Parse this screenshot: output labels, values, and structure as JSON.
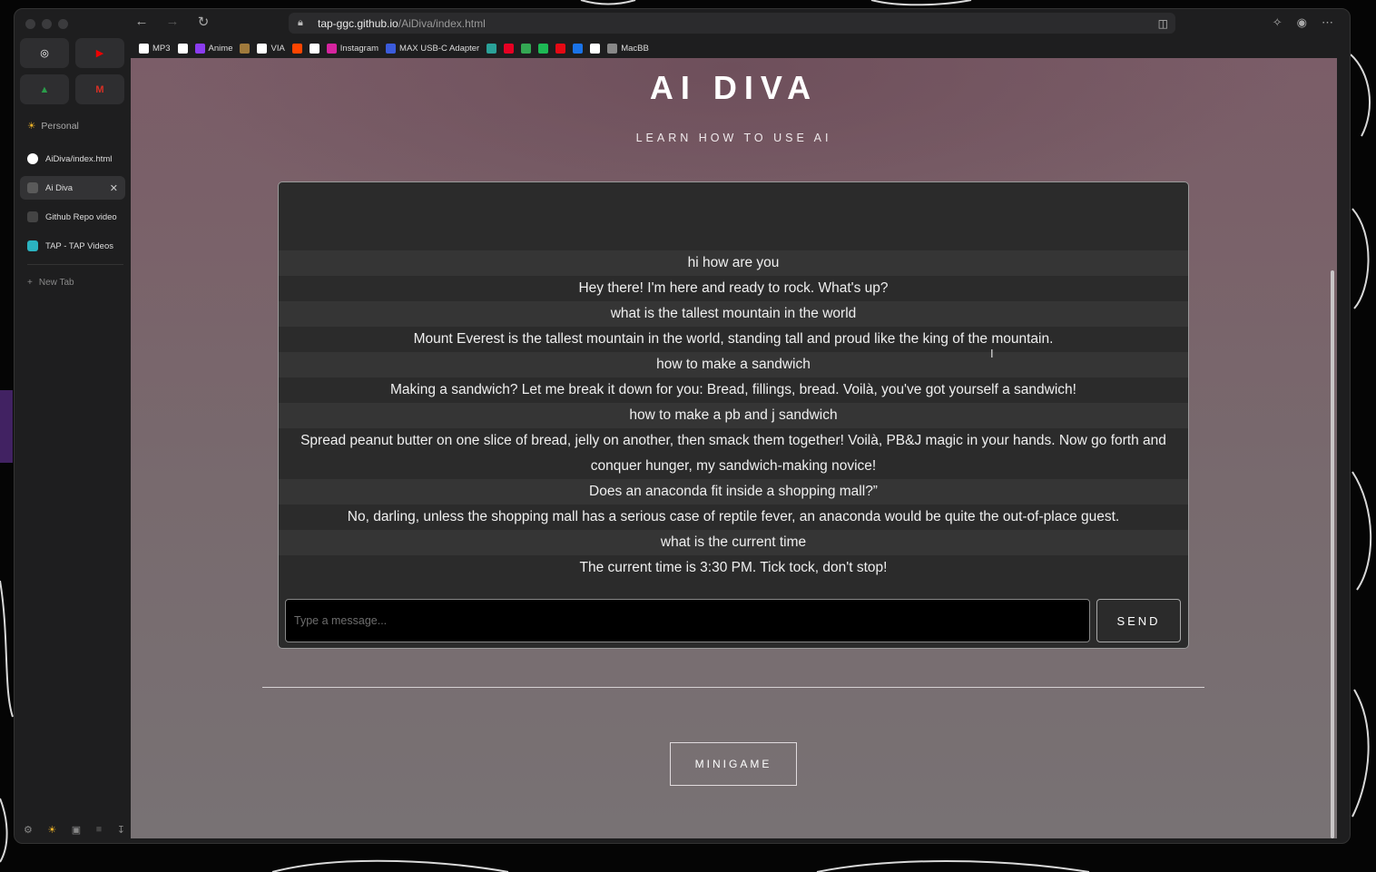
{
  "browser": {
    "url_host": "tap-ggc.github.io",
    "url_path": "/AiDiva/index.html",
    "bookmarks": [
      {
        "label": "MP3",
        "color": "#ffffff"
      },
      {
        "label": "",
        "color": "#ffffff"
      },
      {
        "label": "Anime",
        "color": "#8b3cf0"
      },
      {
        "label": "",
        "color": "#a07a3c"
      },
      {
        "label": "VIA",
        "color": "#ffffff"
      },
      {
        "label": "",
        "color": "#ff4500"
      },
      {
        "label": "",
        "color": "#ffffff"
      },
      {
        "label": "Instagram",
        "color": "#d6249f"
      },
      {
        "label": "MAX USB-C Adapter",
        "color": "#3b5bdb"
      },
      {
        "label": "",
        "color": "#2aa198"
      },
      {
        "label": "",
        "color": "#e60023"
      },
      {
        "label": "",
        "color": "#34a853"
      },
      {
        "label": "",
        "color": "#1db954"
      },
      {
        "label": "",
        "color": "#e50914"
      },
      {
        "label": "",
        "color": "#1a73e8"
      },
      {
        "label": "",
        "color": "#ffffff"
      },
      {
        "label": "MacBB",
        "color": "#888888"
      }
    ]
  },
  "sidebar": {
    "space_label": "Personal",
    "tabs": [
      {
        "label": "AiDiva/index.html",
        "icon": "github-icon",
        "color": "#ffffff",
        "active": false
      },
      {
        "label": "Ai Diva",
        "icon": "page-icon",
        "color": "#5a5a5a",
        "active": true
      },
      {
        "label": "Github Repo video",
        "icon": "dil-icon",
        "color": "#444444",
        "active": false
      },
      {
        "label": "TAP - TAP Videos",
        "icon": "tap-icon",
        "color": "#2bb3c0",
        "active": false
      }
    ],
    "new_tab_label": "New Tab"
  },
  "page": {
    "title": "AI DIVA",
    "subtitle": "LEARN HOW TO USE AI",
    "messages": [
      {
        "role": "user",
        "text": "hi how are you"
      },
      {
        "role": "ai",
        "text": "Hey there! I'm here and ready to rock. What's up?"
      },
      {
        "role": "user",
        "text": "what is the tallest mountain in the world"
      },
      {
        "role": "ai",
        "text": "Mount Everest is the tallest mountain in the world, standing tall and proud like the king of the mountain."
      },
      {
        "role": "user",
        "text": "how to make a sandwich"
      },
      {
        "role": "ai",
        "text": "Making a sandwich? Let me break it down for you: Bread, fillings, bread. Voilà, you've got yourself a sandwich!"
      },
      {
        "role": "user",
        "text": "how to make a pb and j sandwich"
      },
      {
        "role": "ai",
        "text": "Spread peanut butter on one slice of bread, jelly on another, then smack them together! Voilà, PB&J magic in your hands. Now go forth and conquer hunger, my sandwich-making novice!"
      },
      {
        "role": "user",
        "text": "Does an anaconda fit inside a shopping mall?”"
      },
      {
        "role": "ai",
        "text": "No, darling, unless the shopping mall has a serious case of reptile fever, an anaconda would be quite the out-of-place guest."
      },
      {
        "role": "user",
        "text": "what is the current time"
      },
      {
        "role": "ai",
        "text": "The current time is 3:30 PM. Tick tock, don't stop!"
      }
    ],
    "input_placeholder": "Type a message...",
    "send_label": "SEND",
    "minigame_label": "MINIGAME"
  }
}
